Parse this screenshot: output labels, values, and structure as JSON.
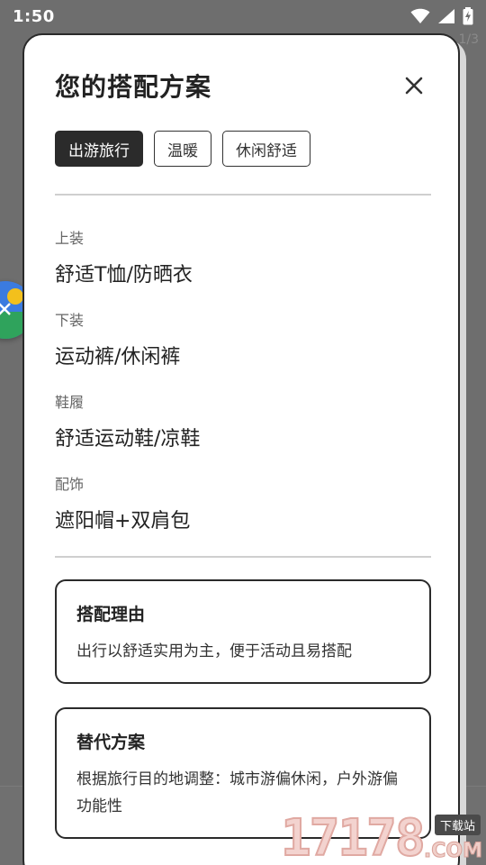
{
  "status_bar": {
    "time": "1:50"
  },
  "background": {
    "counter_text": "1/3"
  },
  "dialog": {
    "title": "您的搭配方案",
    "tags": [
      {
        "label": "出游旅行",
        "active": true
      },
      {
        "label": "温暖",
        "active": false
      },
      {
        "label": "休闲舒适",
        "active": false
      }
    ],
    "items": [
      {
        "label": "上装",
        "value": "舒适T恤/防晒衣"
      },
      {
        "label": "下装",
        "value": "运动裤/休闲裤"
      },
      {
        "label": "鞋履",
        "value": "舒适运动鞋/凉鞋"
      },
      {
        "label": "配饰",
        "value": "遮阳帽+双肩包"
      }
    ],
    "reason_card": {
      "title": "搭配理由",
      "body": "出行以舒适实用为主，便于活动且易搭配"
    },
    "alternative_card": {
      "title": "替代方案",
      "body": "根据旅行目的地调整：城市游偏休闲，户外游偏功能性"
    }
  },
  "watermark": {
    "number": "17178",
    "tag": "下载站",
    "suffix": ".COM"
  },
  "colors": {
    "backdrop": "#6e6e6e",
    "dialog_bg": "#ffffff",
    "active_tag_bg": "#2b2b2b",
    "border": "#2a2a2a"
  }
}
